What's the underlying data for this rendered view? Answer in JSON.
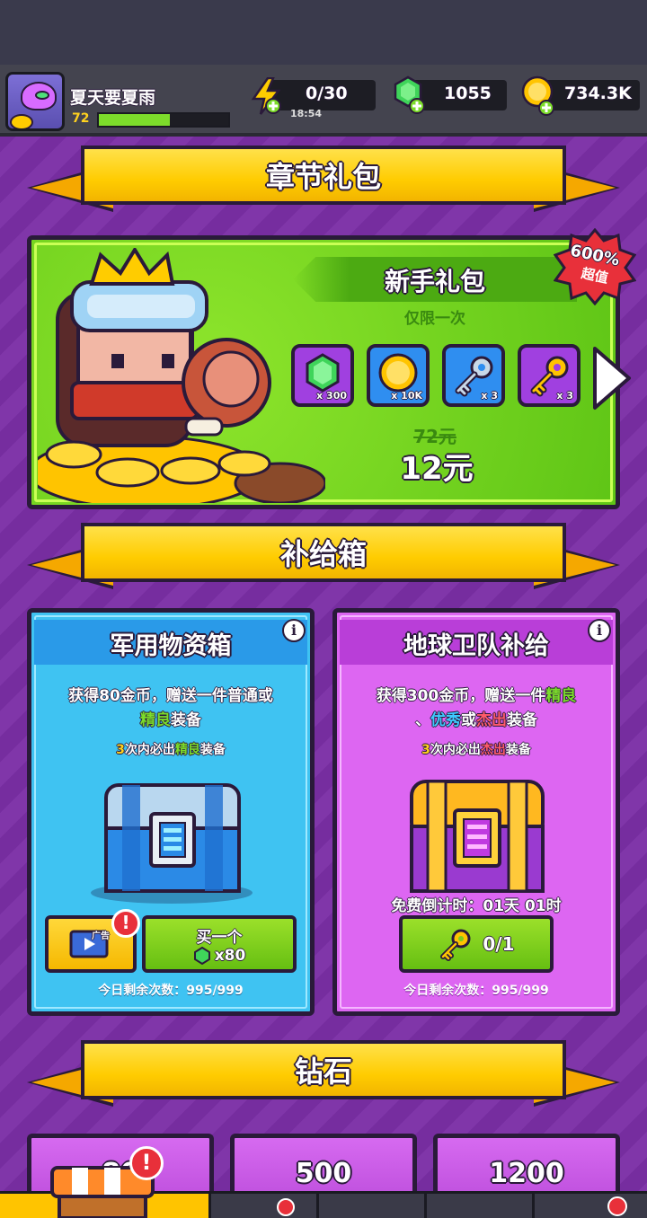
{
  "player": {
    "name": "夏天要夏雨",
    "level": "72",
    "xp_fraction": 0.55
  },
  "resources": {
    "energy": "0/30",
    "energy_timer": "18:54",
    "gems": "1055",
    "coins": "734.3K"
  },
  "sections": {
    "chapter_pack": "章节礼包",
    "supply_box": "补给箱",
    "diamonds": "钻石"
  },
  "starter_pack": {
    "title": "新手礼包",
    "limit": "仅限一次",
    "badge_pct": "600%",
    "badge_sub": "超值",
    "items": [
      {
        "icon": "gem-icon",
        "qty": "x 300"
      },
      {
        "icon": "coin-icon",
        "qty": "x 10K"
      },
      {
        "icon": "silver-key-icon",
        "qty": "x 3"
      },
      {
        "icon": "gold-key-icon",
        "qty": "x 3"
      }
    ],
    "old_price": "72元",
    "price": "12元"
  },
  "military_box": {
    "title": "军用物资箱",
    "desc1": "获得80金币，赠送一件普通或",
    "desc2_hl": "精良",
    "desc2": "装备",
    "guar_num": "3",
    "guar_a": "次内必出",
    "guar_hl": "精良",
    "guar_b": "装备",
    "ad_label": "广告",
    "buy_label": "买一个",
    "buy_price": "x80",
    "remaining": "今日剩余次数：995/999"
  },
  "earth_box": {
    "title": "地球卫队补给",
    "desc1": "获得300金币，赠送一件",
    "desc1_hl": "精良",
    "d2a": "、",
    "d2_hl1": "优秀",
    "d2b": "或",
    "d2_hl2": "杰出",
    "d2c": "装备",
    "guar_num": "3",
    "guar_a": "次内必出",
    "guar_hl": "杰出",
    "guar_b": "装备",
    "countdown": "免费倒计时：01天 01时",
    "key_count": "0/1",
    "remaining": "今日剩余次数：995/999"
  },
  "diamond_packs": [
    {
      "amount": "80"
    },
    {
      "amount": "500"
    },
    {
      "amount": "1200"
    }
  ],
  "colors": {
    "bg": "#7b2fa6",
    "green_card": "#6fd11e",
    "blue_card": "#3fc3f2",
    "pink_card": "#dd66f2",
    "banner": "#ffcc00"
  }
}
